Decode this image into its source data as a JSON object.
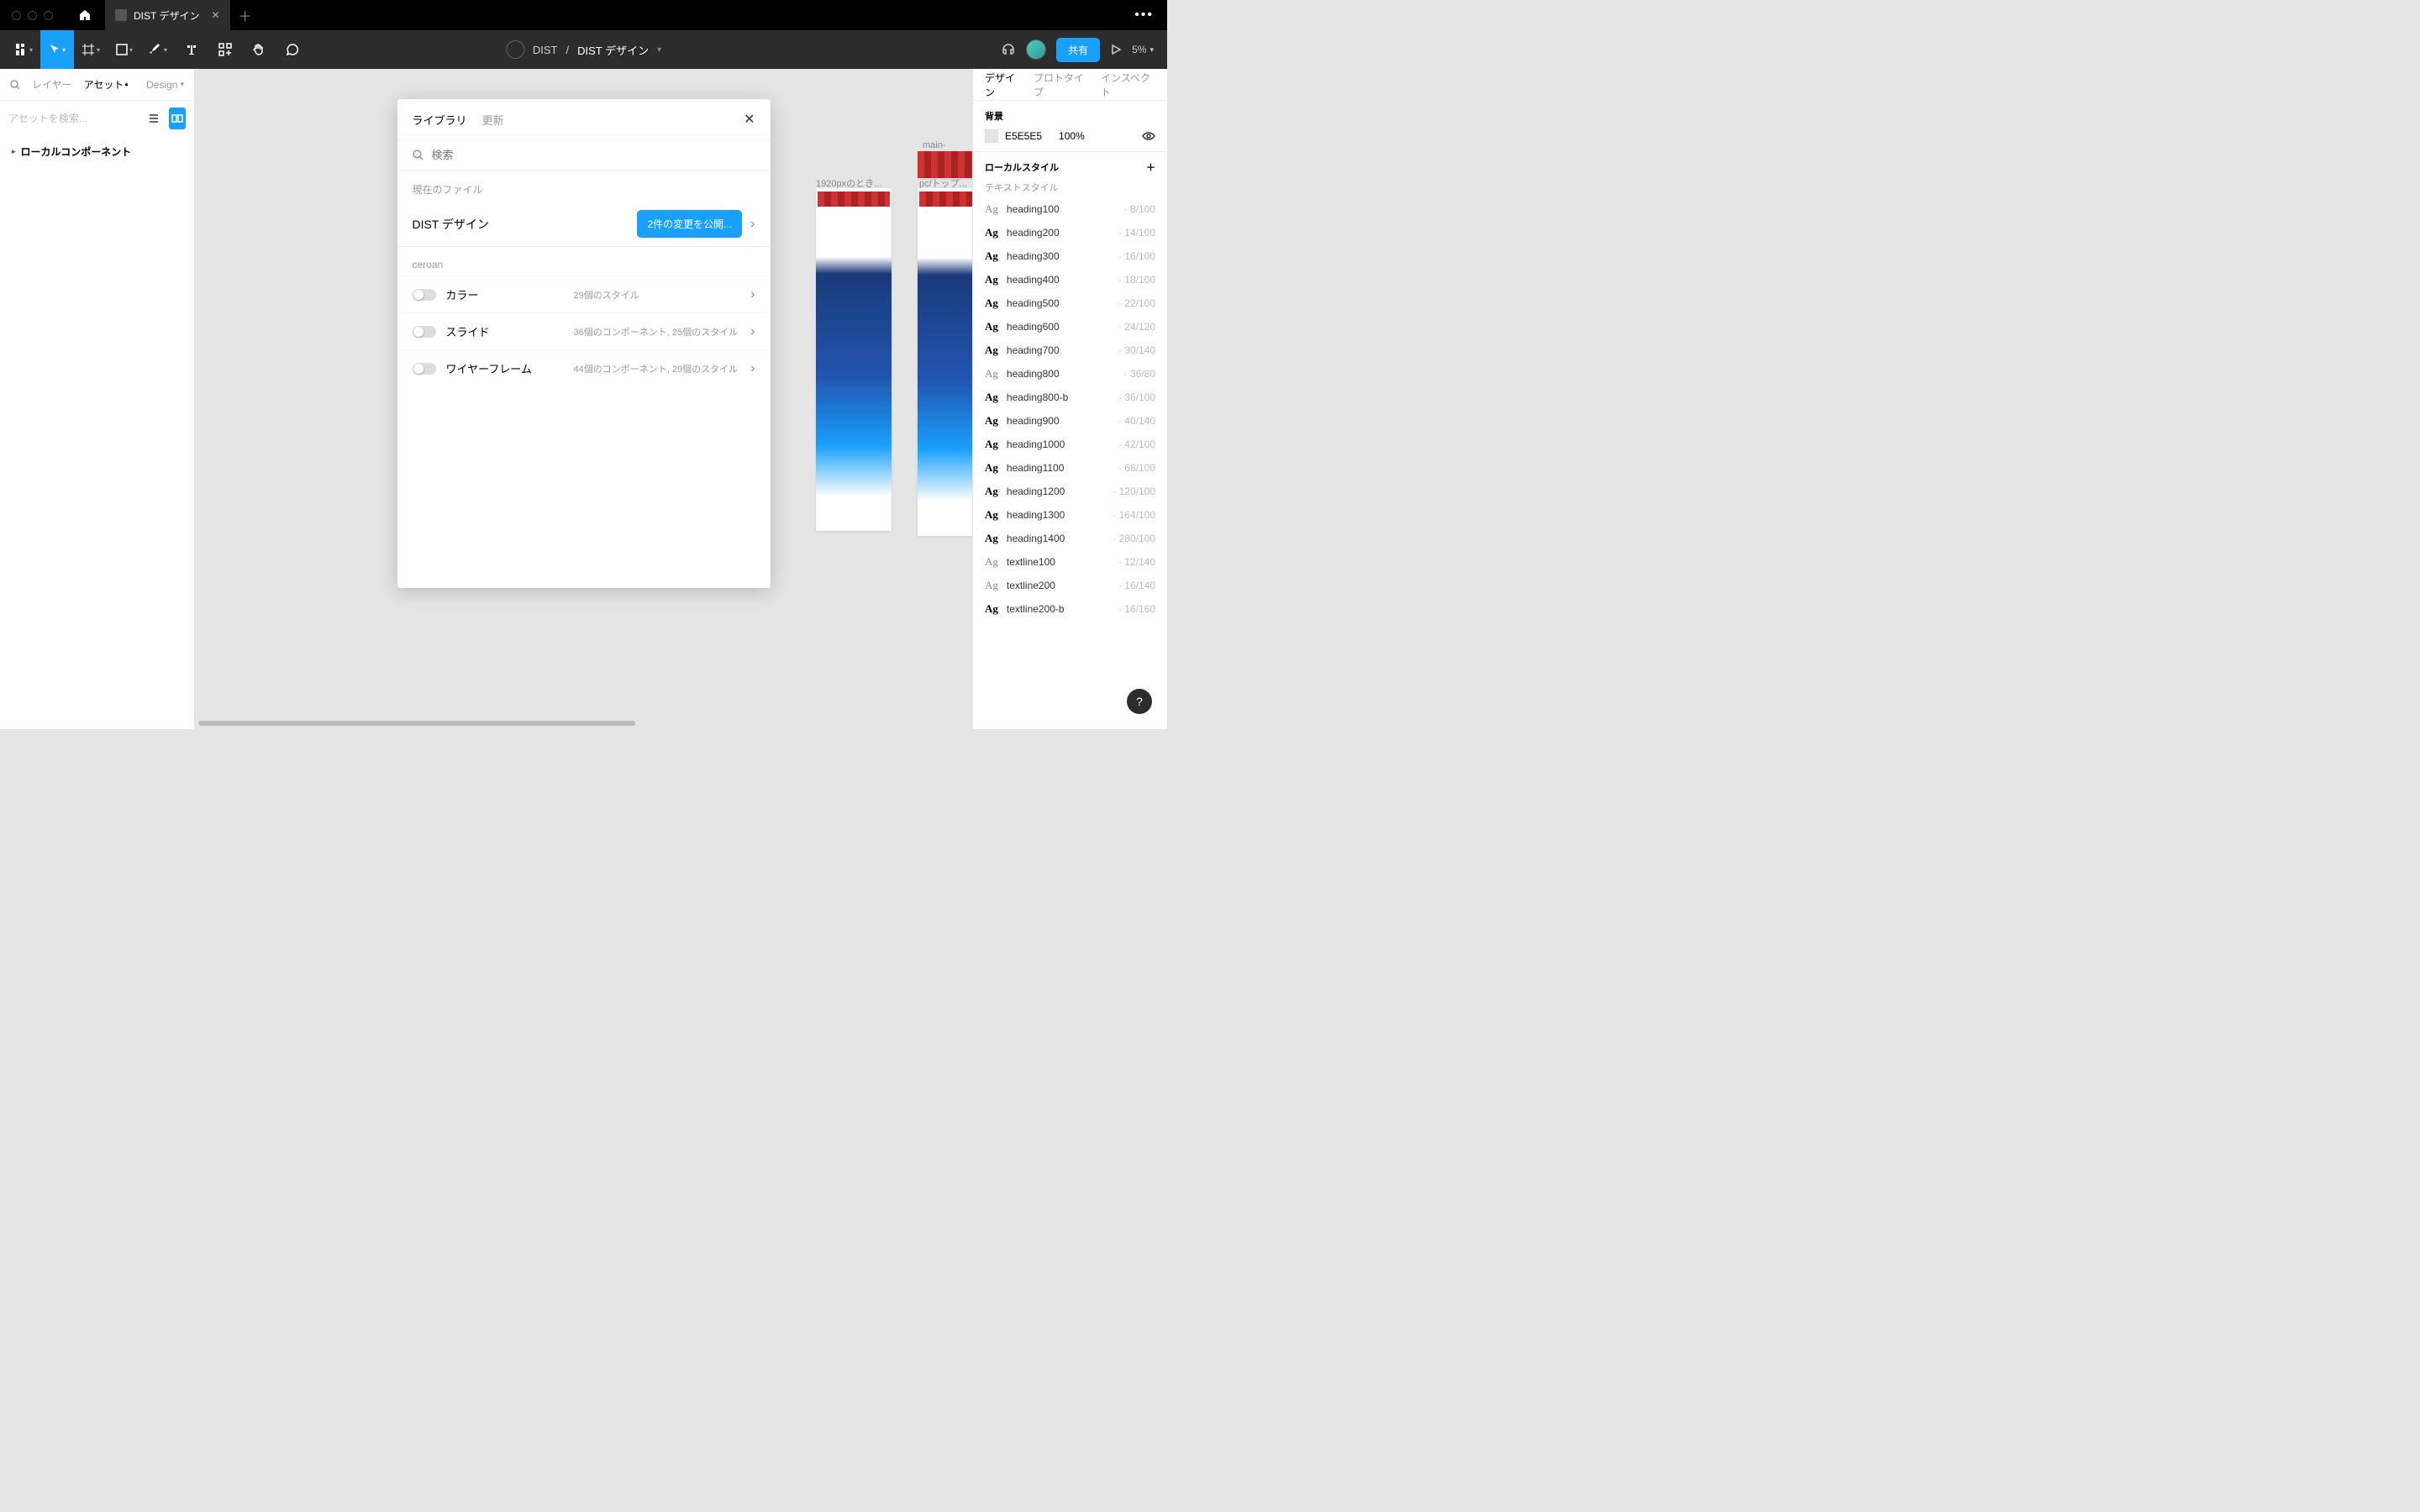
{
  "window": {
    "tab_title": "DIST デザイン"
  },
  "toolbar": {
    "project": "DIST",
    "file": "DIST デザイン",
    "share": "共有",
    "zoom": "5%"
  },
  "left_panel": {
    "tab_layers": "レイヤー",
    "tab_assets": "アセット",
    "design_dd": "Design",
    "search_placeholder": "アセットを検索...",
    "local_components": "ローカルコンポーネント"
  },
  "canvas": {
    "label1": "1920pxのとき...",
    "label2": "main-slide...",
    "label3": "pc/トップ..."
  },
  "modal": {
    "tab_library": "ライブラリ",
    "tab_update": "更新",
    "search_placeholder": "検索",
    "current_file_label": "現在のファイル",
    "file_name": "DIST デザイン",
    "publish_button": "2件の変更を公開...",
    "team_label": "ceroan",
    "libs": [
      {
        "name": "カラー",
        "meta": "29個のスタイル"
      },
      {
        "name": "スライド",
        "meta": "36個のコンポーネント, 25個のスタイル"
      },
      {
        "name": "ワイヤーフレーム",
        "meta": "44個のコンポーネント, 29個のスタイル"
      }
    ]
  },
  "right_panel": {
    "tab_design": "デザイン",
    "tab_prototype": "プロトタイプ",
    "tab_inspect": "インスペクト",
    "bg_label": "背景",
    "bg_hex": "E5E5E5",
    "bg_opacity": "100%",
    "local_styles": "ローカルスタイル",
    "text_styles_label": "テキストスタイル",
    "text_styles": [
      {
        "name": "heading100",
        "meta": "8/100",
        "weight": "light"
      },
      {
        "name": "heading200",
        "meta": "14/100",
        "weight": "bold"
      },
      {
        "name": "heading300",
        "meta": "16/100",
        "weight": "bold"
      },
      {
        "name": "heading400",
        "meta": "18/100",
        "weight": "bold"
      },
      {
        "name": "heading500",
        "meta": "22/100",
        "weight": "bold"
      },
      {
        "name": "heading600",
        "meta": "24/120",
        "weight": "bold"
      },
      {
        "name": "heading700",
        "meta": "30/140",
        "weight": "bold"
      },
      {
        "name": "heading800",
        "meta": "36/80",
        "weight": "light"
      },
      {
        "name": "heading800-b",
        "meta": "36/100",
        "weight": "bold"
      },
      {
        "name": "heading900",
        "meta": "40/140",
        "weight": "bold"
      },
      {
        "name": "heading1000",
        "meta": "42/100",
        "weight": "bold"
      },
      {
        "name": "heading1100",
        "meta": "68/100",
        "weight": "bold"
      },
      {
        "name": "heading1200",
        "meta": "120/100",
        "weight": "bold"
      },
      {
        "name": "heading1300",
        "meta": "164/100",
        "weight": "bold"
      },
      {
        "name": "heading1400",
        "meta": "280/100",
        "weight": "bold"
      },
      {
        "name": "textline100",
        "meta": "12/140",
        "weight": "light"
      },
      {
        "name": "textline200",
        "meta": "16/140",
        "weight": "light"
      },
      {
        "name": "textline200-b",
        "meta": "16/160",
        "weight": "bold"
      }
    ]
  },
  "help": "?"
}
